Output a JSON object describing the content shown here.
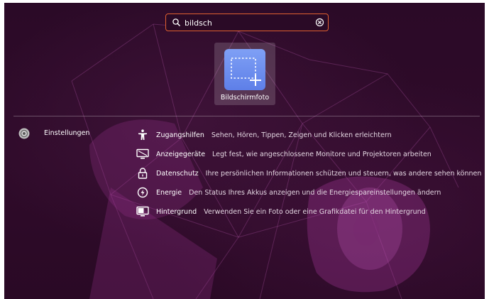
{
  "search": {
    "value": "bildsch",
    "icon": "search-icon",
    "clear_icon": "clear-icon"
  },
  "apps": [
    {
      "label": "Bildschirmfoto",
      "icon": "screenshot-icon"
    }
  ],
  "provider": {
    "name": "Einstellungen",
    "icon": "settings-gear-icon"
  },
  "results": [
    {
      "title": "Zugangshilfen",
      "description": "Sehen, Hören, Tippen, Zeigen und Klicken erleichtern",
      "icon": "accessibility-icon"
    },
    {
      "title": "Anzeigegeräte",
      "description": "Legt fest, wie angeschlossene Monitore und Projektoren arbeiten",
      "icon": "display-icon"
    },
    {
      "title": "Datenschutz",
      "description": "Ihre persönlichen Informationen schützen und steuern, was andere sehen können",
      "icon": "privacy-lock-icon"
    },
    {
      "title": "Energie",
      "description": "Den Status Ihres Akkus anzeigen und die Energiespareinstellungen ändern",
      "icon": "power-icon"
    },
    {
      "title": "Hintergrund",
      "description": "Verwenden Sie ein Foto oder eine Grafikdatei für den Hintergrund",
      "icon": "background-icon"
    }
  ],
  "colors": {
    "background": "#2c0a28",
    "search_border": "#e06030",
    "app_icon_blue": "#6f8ff0"
  }
}
